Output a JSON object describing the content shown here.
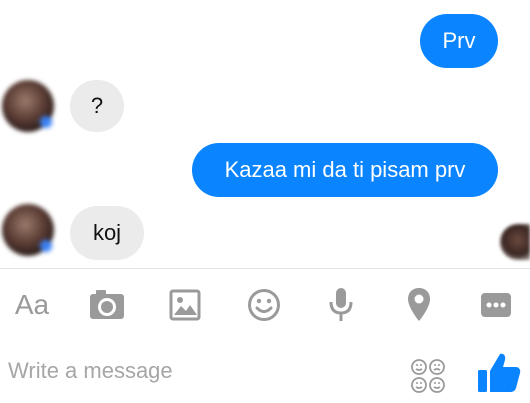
{
  "messages": [
    {
      "direction": "outgoing",
      "text": "Prv"
    },
    {
      "direction": "incoming",
      "text": "?"
    },
    {
      "direction": "outgoing",
      "text": "Kazaa mi da ti pisam prv"
    },
    {
      "direction": "incoming",
      "text": "koj"
    }
  ],
  "toolbar": {
    "text_format_label": "Aa",
    "icons": [
      "camera-icon",
      "image-icon",
      "emoji-icon",
      "microphone-icon",
      "location-pin-icon",
      "more-icon"
    ]
  },
  "composer": {
    "placeholder": "Write a message",
    "value": "",
    "sticker_icon": "sticker-faces-icon",
    "send_icon": "thumbs-up-icon"
  },
  "colors": {
    "outgoing_bubble": "#0a84ff",
    "incoming_bubble": "#ebebeb",
    "toolbar_icon": "#9a9a9a",
    "like_button": "#0a84ff"
  }
}
